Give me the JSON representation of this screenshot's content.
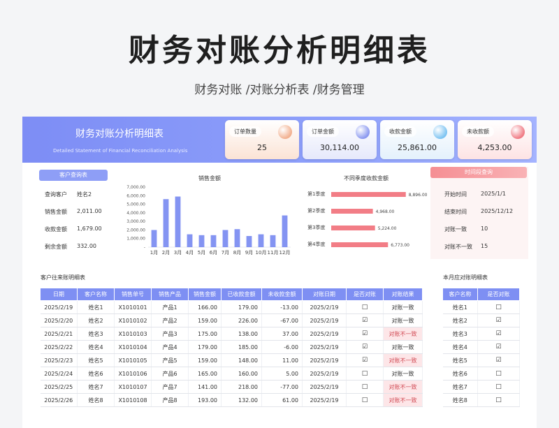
{
  "header": {
    "title": "财务对账分析明细表",
    "subtitle": "财务对账 /对账分析表 /财务管理"
  },
  "banner": {
    "title": "财务对账分析明细表",
    "subtitle": "Detailed Statement of Financial Reconciliation Analysis"
  },
  "kpis": [
    {
      "label": "订单数量",
      "value": "25",
      "bg": "#fbe3d5",
      "dot": "#f2b08f"
    },
    {
      "label": "订单金额",
      "value": "30,114.00",
      "bg": "#e6e9fb",
      "dot": "#8a98f0"
    },
    {
      "label": "收款金额",
      "value": "25,861.00",
      "bg": "#e4f1fc",
      "dot": "#7cc3f2"
    },
    {
      "label": "未收款额",
      "value": "4,253.00",
      "bg": "#fde3e4",
      "dot": "#f07a84"
    }
  ],
  "customer_query": {
    "title": "客户查询表",
    "rows": [
      {
        "label": "查询客户",
        "value": "姓名2"
      },
      {
        "label": "销售金额",
        "value": "2,011.00"
      },
      {
        "label": "收款金额",
        "value": "1,679.00"
      },
      {
        "label": "剩余金额",
        "value": "332.00"
      }
    ]
  },
  "sales_chart": {
    "title": "销售金额",
    "chart_data": {
      "type": "bar",
      "title": "销售金额",
      "categories": [
        "1月",
        "2月",
        "3月",
        "4月",
        "5月",
        "6月",
        "7月",
        "8月",
        "9月",
        "10月",
        "11月",
        "12月"
      ],
      "values": [
        2000,
        5600,
        5900,
        1500,
        1400,
        1400,
        2000,
        2100,
        1300,
        1500,
        1400,
        3700
      ],
      "ylim": [
        0,
        7000
      ],
      "yticks": [
        "7,000.00",
        "6,000.00",
        "5,000.00",
        "4,000.00",
        "3,000.00",
        "2,000.00",
        "1,000.00",
        "-"
      ]
    }
  },
  "quarter_chart": {
    "title": "不同季度收款金额",
    "chart_data": {
      "type": "bar",
      "orientation": "horizontal",
      "title": "不同季度收款金额",
      "categories": [
        "第1季度",
        "第2季度",
        "第3季度",
        "第4季度"
      ],
      "values": [
        8896,
        4968,
        5224,
        6773
      ],
      "labels": [
        "8,896.00",
        "4,968.00",
        "5,224.00",
        "6,773.00"
      ],
      "xlim": [
        0,
        10000
      ]
    }
  },
  "time_query": {
    "title": "时间段查询",
    "rows": [
      {
        "label": "开始时间",
        "value": "2025/1/1"
      },
      {
        "label": "结束时间",
        "value": "2025/12/12"
      },
      {
        "label": "对账一致",
        "value": "10"
      },
      {
        "label": "对账不一致",
        "value": "15"
      }
    ]
  },
  "detail_table": {
    "title": "客户往来账明细表",
    "headers": [
      "日期",
      "客户名称",
      "销售单号",
      "销售产品",
      "销售金额",
      "已收款金额",
      "未收款金额",
      "对账日期",
      "是否对账",
      "对账结果"
    ],
    "rows": [
      [
        "2025/2/19",
        "姓名1",
        "X1010101",
        "产品1",
        "166.00",
        "179.00",
        "-13.00",
        "2025/2/19",
        "□",
        "对账一致"
      ],
      [
        "2025/2/20",
        "姓名2",
        "X1010102",
        "产品2",
        "159.00",
        "226.00",
        "-67.00",
        "2025/2/19",
        "☑",
        "对账一致"
      ],
      [
        "2025/2/21",
        "姓名3",
        "X1010103",
        "产品3",
        "175.00",
        "138.00",
        "37.00",
        "2025/2/19",
        "☑",
        "对账不一致"
      ],
      [
        "2025/2/22",
        "姓名4",
        "X1010104",
        "产品4",
        "179.00",
        "185.00",
        "-6.00",
        "2025/2/19",
        "☑",
        "对账一致"
      ],
      [
        "2025/2/23",
        "姓名5",
        "X1010105",
        "产品5",
        "159.00",
        "148.00",
        "11.00",
        "2025/2/19",
        "☑",
        "对账不一致"
      ],
      [
        "2025/2/24",
        "姓名6",
        "X1010106",
        "产品6",
        "165.00",
        "160.00",
        "5.00",
        "2025/2/19",
        "□",
        "对账一致"
      ],
      [
        "2025/2/25",
        "姓名7",
        "X1010107",
        "产品7",
        "141.00",
        "218.00",
        "-77.00",
        "2025/2/19",
        "□",
        "对账不一致"
      ],
      [
        "2025/2/26",
        "姓名8",
        "X1010108",
        "产品8",
        "193.00",
        "132.00",
        "61.00",
        "2025/2/19",
        "□",
        "对账不一致"
      ]
    ]
  },
  "month_table": {
    "title": "本月应对账明细表",
    "headers": [
      "客户名称",
      "是否对账"
    ],
    "rows": [
      [
        "姓名1",
        "□"
      ],
      [
        "姓名2",
        "☑"
      ],
      [
        "姓名3",
        "☑"
      ],
      [
        "姓名4",
        "☑"
      ],
      [
        "姓名5",
        "☑"
      ],
      [
        "姓名6",
        "□"
      ],
      [
        "姓名7",
        "□"
      ],
      [
        "姓名8",
        "□"
      ]
    ]
  },
  "colors": {
    "accent": "#7e8ff3",
    "mismatch": "#fde6e8",
    "bar_blue": "#8494f2",
    "bar_red": "#f27d86"
  }
}
